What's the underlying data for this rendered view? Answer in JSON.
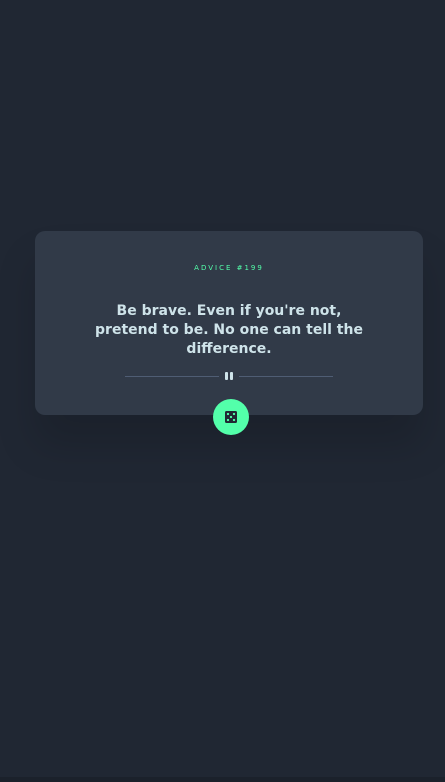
{
  "card": {
    "advice_id": "ADVICE #199",
    "advice_text": "Be brave. Even if you're not, pretend to be. No one can tell the difference."
  },
  "icons": {
    "divider": "pause-icon",
    "button": "dice-icon"
  },
  "colors": {
    "background": "#202733",
    "card": "#313a48",
    "accent": "#53ffaa",
    "text": "#cee3e9",
    "divider": "#4f5d74"
  }
}
